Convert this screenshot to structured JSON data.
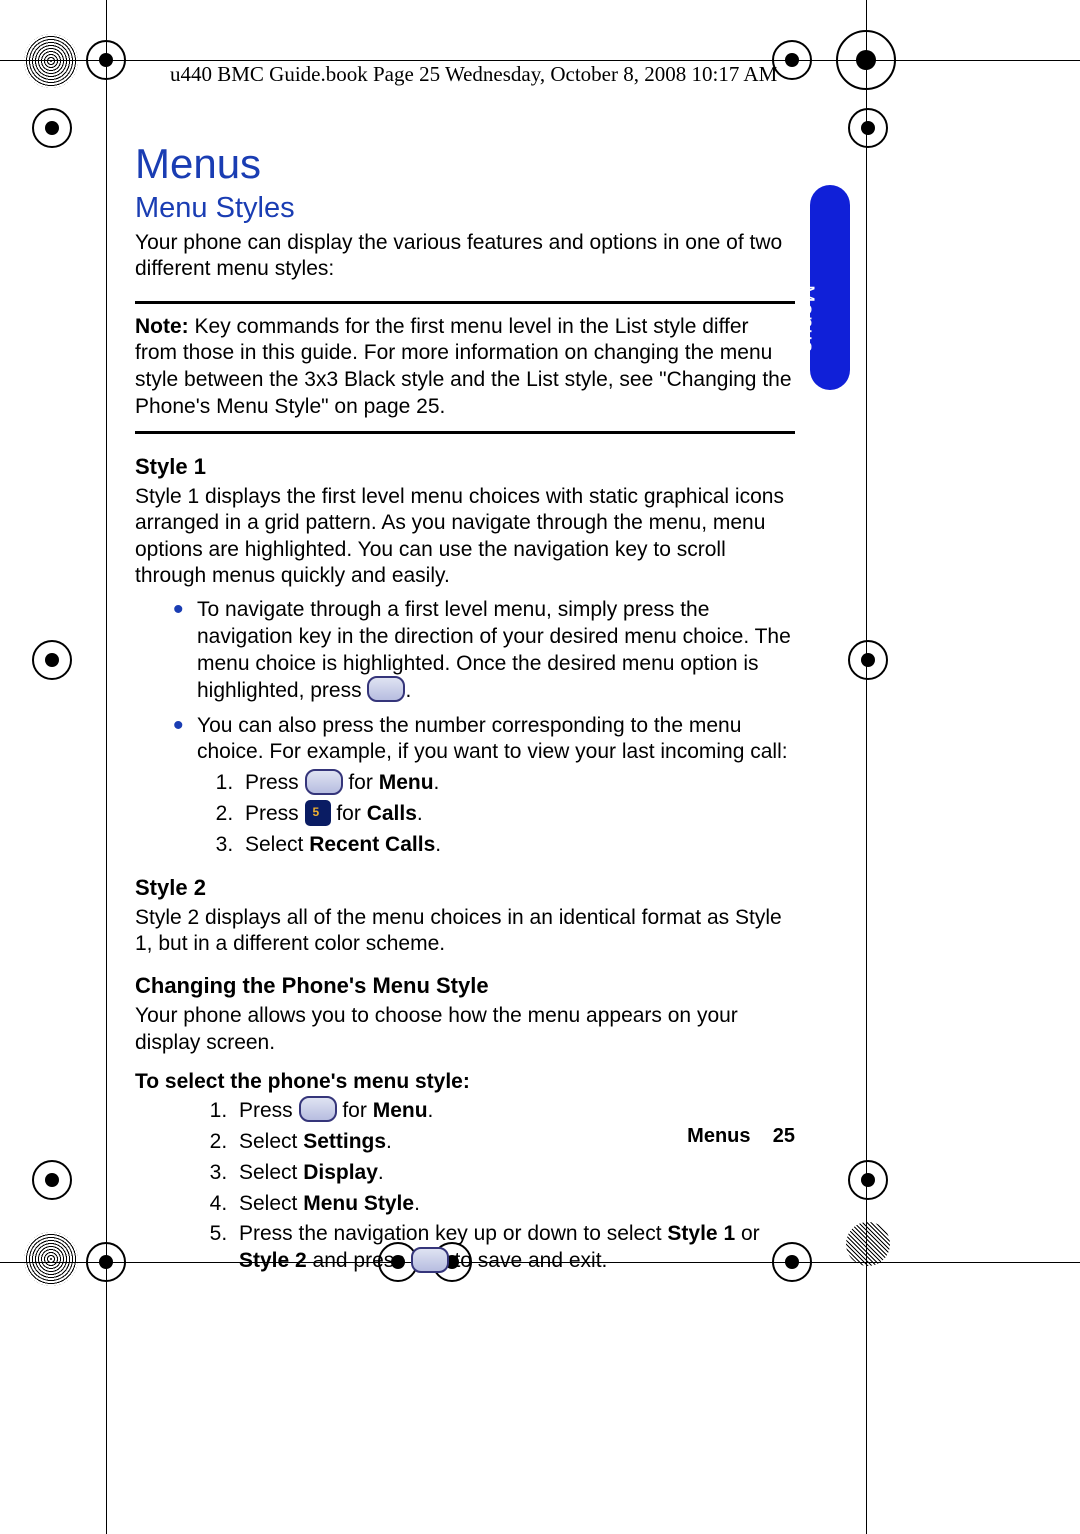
{
  "header": "u440 BMC Guide.book  Page 25  Wednesday, October 8, 2008  10:17 AM",
  "chapter_title": "Menus",
  "section_title": "Menu Styles",
  "intro": "Your phone can display the various features and options in one of two different menu styles:",
  "note_label": "Note:",
  "note_body": " Key commands for the first menu level in the List style differ from those in this guide. For more information on changing the menu style between the 3x3 Black style and the List style, see \"Changing the Phone's Menu Style\" on page 25.",
  "style1_h": "Style 1",
  "style1_p": "Style 1 displays the first level menu choices with static graphical icons arranged in a grid pattern. As you navigate through the menu, menu options are highlighted. You can use the navigation key to scroll through menus quickly and easily.",
  "style1_b1a": "To navigate through a first level menu, simply press the navigation key in the direction of your desired menu choice. The menu choice is highlighted. Once the desired menu option is highlighted, press ",
  "style1_b1b": ".",
  "style1_b2": "You can also press the number corresponding to the menu choice. For example, if you want to view your last incoming call:",
  "steps1": {
    "s1a": "Press ",
    "s1b": " for ",
    "s1c": "Menu",
    "s1d": ".",
    "s2a": "Press ",
    "s2b": " for ",
    "s2c": "Calls",
    "s2d": ".",
    "s3a": "Select ",
    "s3b": "Recent Calls",
    "s3c": "."
  },
  "style2_h": "Style 2",
  "style2_p": "Style 2 displays all of the menu choices in an identical format as Style 1, but in a different color scheme.",
  "change_h": "Changing the Phone's Menu Style",
  "change_p": "Your phone allows you to choose how the menu appears on your display screen.",
  "select_h": "To select the phone's menu style:",
  "steps2": {
    "s1a": "Press ",
    "s1b": " for ",
    "s1c": "Menu",
    "s1d": ".",
    "s2a": "Select ",
    "s2b": "Settings",
    "s2c": ".",
    "s3a": "Select ",
    "s3b": "Display",
    "s3c": ".",
    "s4a": "Select ",
    "s4b": "Menu Style",
    "s4c": ".",
    "s5a": "Press the navigation key up or down to select ",
    "s5b": "Style 1",
    "s5c": " or ",
    "s5d": "Style 2",
    "s5e": " and press ",
    "s5f": " to save and exit."
  },
  "side_tab": "Menus",
  "footer_label": "Menus",
  "footer_page": "25"
}
